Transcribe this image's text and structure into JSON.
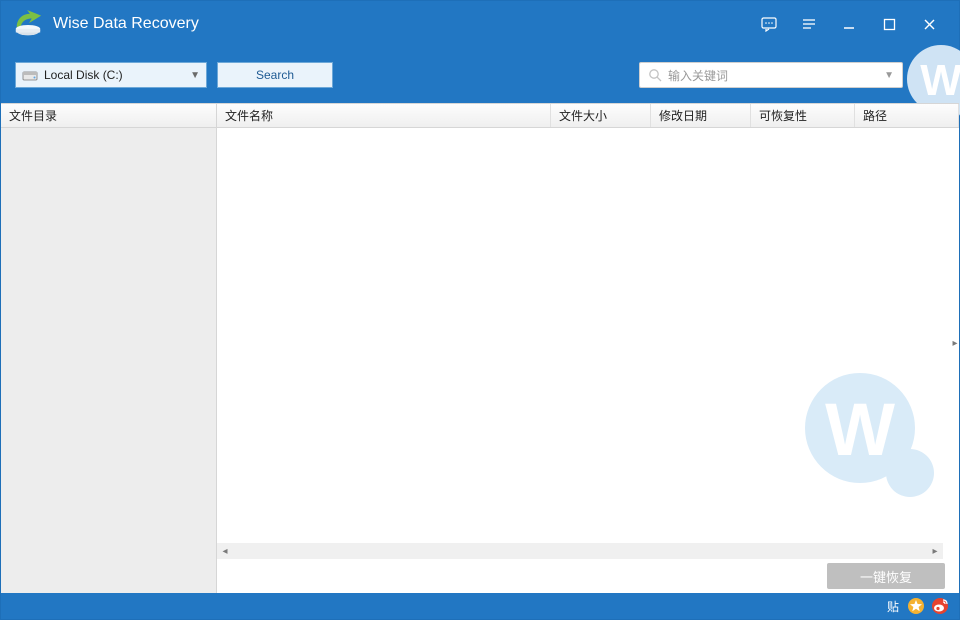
{
  "app": {
    "title": "Wise Data Recovery"
  },
  "toolbar": {
    "drive_selected": "Local Disk (C:)",
    "search_label": "Search",
    "keyword_placeholder": "输入关键词"
  },
  "sidebar": {
    "header": "文件目录"
  },
  "columns": {
    "name": "文件名称",
    "size": "文件大小",
    "date": "修改日期",
    "recoverability": "可恢复性",
    "path": "路径"
  },
  "actions": {
    "recover_label": "一键恢复"
  },
  "status": {
    "tieba_label": "贴"
  },
  "colors": {
    "primary": "#2277c3",
    "sidebar_bg": "#ededed",
    "disabled_btn": "#bfbfbf"
  }
}
